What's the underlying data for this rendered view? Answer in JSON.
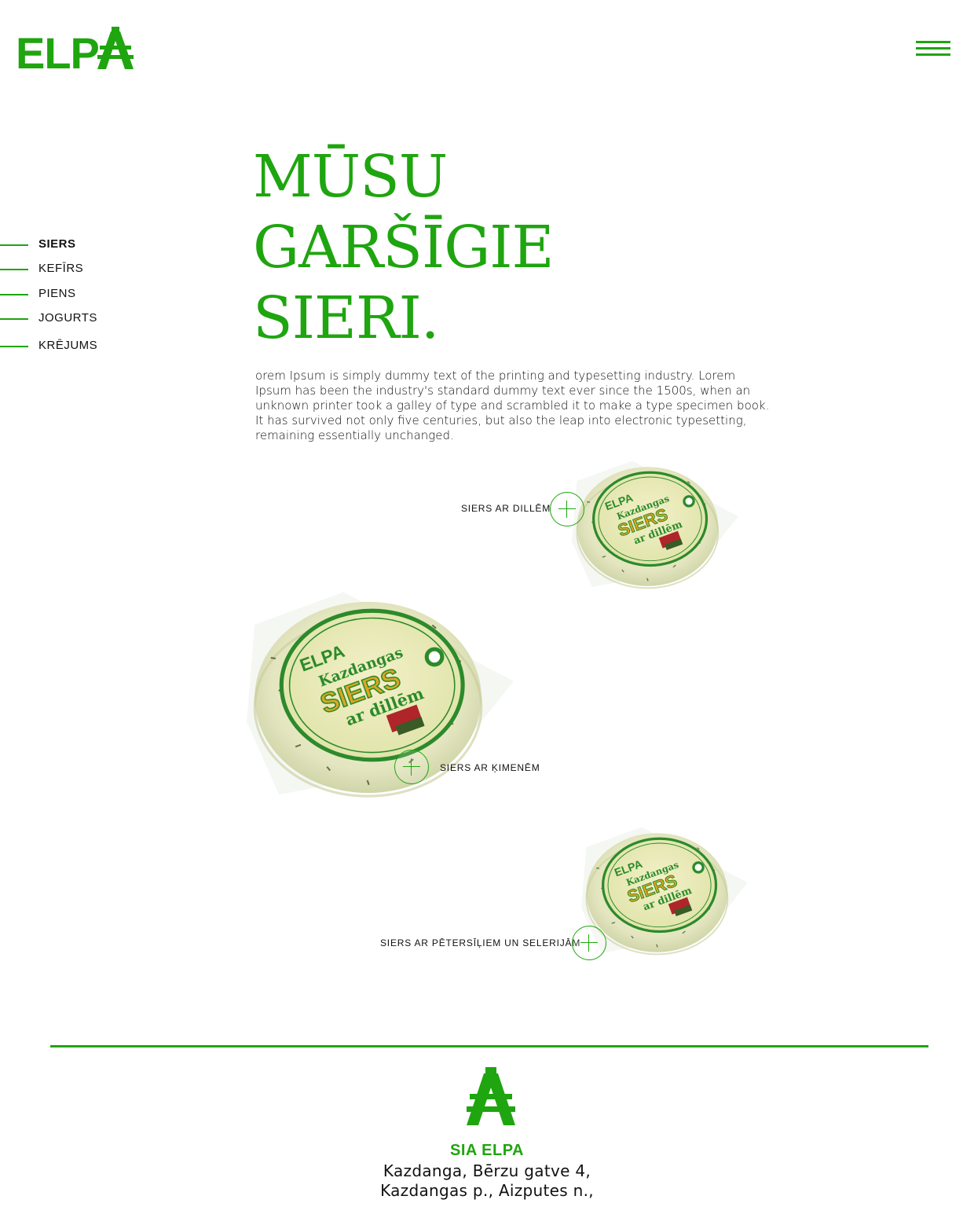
{
  "brand": {
    "logo_text": "ELP",
    "color": "#1fa50f"
  },
  "nav": {
    "menu_icon": "hamburger-menu-icon"
  },
  "categories": [
    {
      "label": "SIERS",
      "active": true
    },
    {
      "label": "KEFĪRS",
      "active": false
    },
    {
      "label": "PIENS",
      "active": false
    },
    {
      "label": "JOGURTS",
      "active": false
    },
    {
      "label": "KRĒJUMS",
      "active": false
    }
  ],
  "hero": {
    "title_lines": [
      "MŪSU",
      "GARŠĪGIE",
      "SIERI."
    ],
    "intro": "orem Ipsum is simply dummy text of the printing and typesetting industry. Lorem Ipsum has been the industry's standard dummy text ever since the 1500s, when an unknown printer took a galley of type and scrambled it to make a type specimen book. It has survived not only five centuries, but also the leap into electronic typesetting, remaining essentially unchanged."
  },
  "products": [
    {
      "label": "SIERS AR DILLĒM",
      "icon": "plus-icon"
    },
    {
      "label": "SIERS AR ĶIMENĒM",
      "icon": "plus-icon"
    },
    {
      "label": "SIERS AR PĒTERSĪĻIEM UN SELERIJĀM",
      "icon": "plus-icon"
    }
  ],
  "cheese_packaging": {
    "brand": "ELPA",
    "line1": "Kazdangas",
    "line2": "SIERS",
    "line3": "ar dillēm"
  },
  "footer": {
    "company": "SIA ELPA",
    "address_line1": "Kazdanga, Bērzu gatve 4,",
    "address_line2": "Kazdangas p., Aizputes n.,"
  }
}
